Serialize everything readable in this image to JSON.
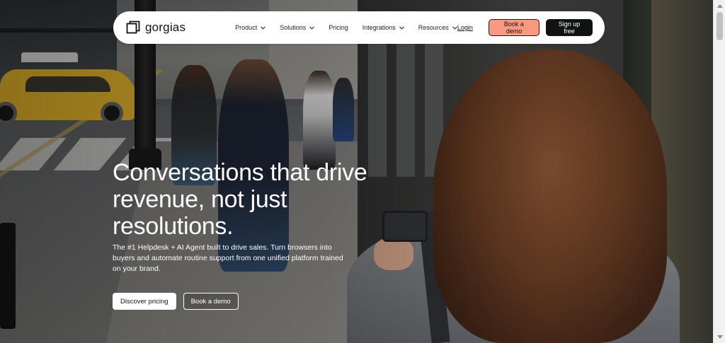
{
  "nav": {
    "logo_text": "gorgias",
    "menu": [
      {
        "label": "Product",
        "has_dropdown": true
      },
      {
        "label": "Solutions",
        "has_dropdown": true
      },
      {
        "label": "Pricing",
        "has_dropdown": false
      },
      {
        "label": "Integrations",
        "has_dropdown": true
      },
      {
        "label": "Resources",
        "has_dropdown": true
      }
    ],
    "login_label": "Login",
    "book_demo_label": "Book a demo",
    "signup_label": "Sign up free"
  },
  "hero": {
    "headline": "Conversations that drive revenue, not just resolutions.",
    "subtext": "The #1 Helpdesk + AI Agent built to drive sales. Turn browsers into buyers and automate routine support from one unified platform trained on your brand.",
    "cta_pricing_label": "Discover pricing",
    "cta_demo_label": "Book a demo"
  },
  "icons": {
    "logo": "gorgias-logo-icon",
    "dropdown": "chevron-down-icon"
  },
  "colors": {
    "nav_bg": "#ffffff",
    "demo_button_bg": "#f99a80",
    "signup_button_bg": "#111214",
    "hero_text": "#ffffff"
  }
}
